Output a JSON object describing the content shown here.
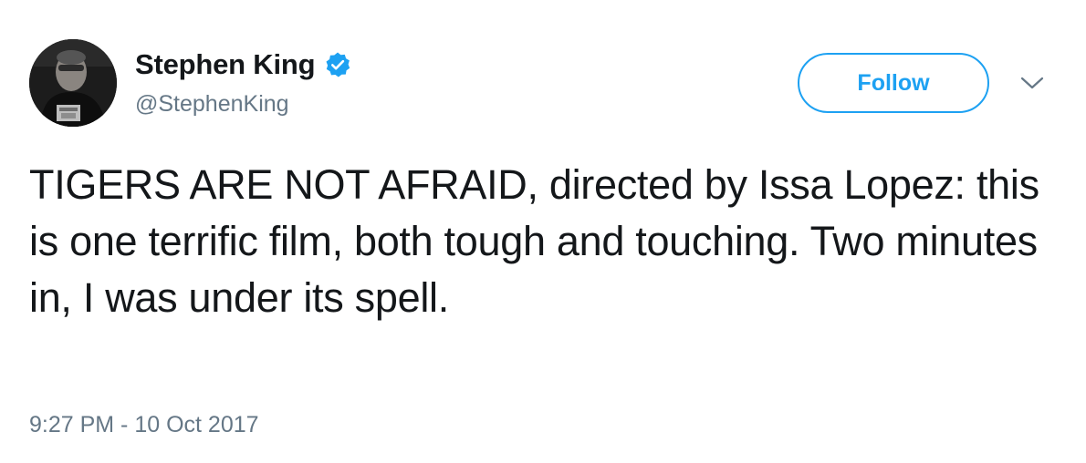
{
  "user": {
    "display_name": "Stephen King",
    "handle": "@StephenKing",
    "verified": true,
    "verified_icon": "verified-badge-icon"
  },
  "actions": {
    "follow_label": "Follow",
    "more_icon": "chevron-down-icon"
  },
  "tweet": {
    "text": "TIGERS ARE NOT AFRAID, directed by Issa Lopez: this is one terrific film, both tough and touching. Two minutes in, I was under its spell.",
    "timestamp": "9:27 PM - 10 Oct 2017"
  },
  "colors": {
    "accent": "#1da1f2",
    "text": "#14171a",
    "secondary_text": "#657786"
  }
}
